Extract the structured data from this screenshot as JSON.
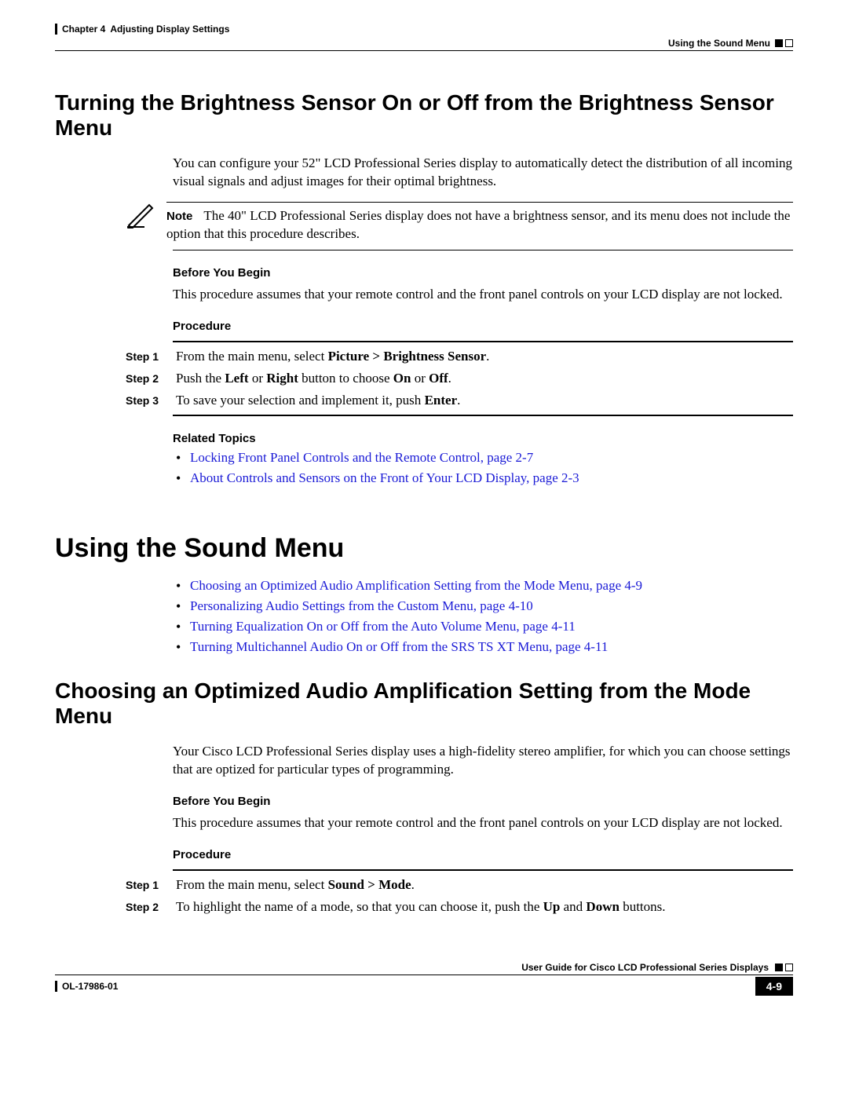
{
  "header": {
    "chapter_prefix": "Chapter 4",
    "chapter_title": "Adjusting Display Settings",
    "section": "Using the Sound Menu"
  },
  "s1": {
    "heading": "Turning the Brightness Sensor On or Off from the Brightness Sensor Menu",
    "intro": "You can configure your 52\" LCD Professional Series display to automatically detect the distribution of all incoming visual signals and adjust images for their optimal brightness.",
    "note_label": "Note",
    "note_text": "The 40\" LCD Professional Series display does not have a brightness sensor, and its menu does not include the option that this procedure describes.",
    "before_label": "Before You Begin",
    "before_text": "This procedure assumes that your remote control and the front panel controls on your LCD display are not locked.",
    "procedure_label": "Procedure",
    "steps": {
      "s1": {
        "label": "Step 1",
        "text_a": "From the main menu, select ",
        "b1": "Picture > Brightness Sensor",
        "text_b": "."
      },
      "s2": {
        "label": "Step 2",
        "text_a": "Push the ",
        "b1": "Left",
        "text_b": " or ",
        "b2": "Right",
        "text_c": " button to choose ",
        "b3": "On",
        "text_d": " or ",
        "b4": "Off",
        "text_e": "."
      },
      "s3": {
        "label": "Step 3",
        "text_a": "To save your selection and implement it, push ",
        "b1": "Enter",
        "text_b": "."
      }
    },
    "related_label": "Related Topics",
    "related": {
      "r1": "Locking Front Panel Controls and the Remote Control, page 2-7",
      "r2": "About Controls and Sensors on the Front of Your LCD Display, page 2-3"
    }
  },
  "s2": {
    "heading": "Using the Sound Menu",
    "links": {
      "l1": "Choosing an Optimized Audio Amplification Setting from the Mode Menu, page 4-9",
      "l2": "Personalizing Audio Settings from the Custom Menu, page 4-10",
      "l3": "Turning Equalization On or Off from the Auto Volume Menu, page 4-11",
      "l4": "Turning Multichannel Audio On or Off from the SRS TS XT Menu, page 4-11"
    }
  },
  "s3": {
    "heading": "Choosing an Optimized Audio Amplification Setting from the Mode Menu",
    "intro": "Your Cisco LCD Professional Series display uses a high-fidelity stereo amplifier, for which you can choose settings that are optized for particular types of programming.",
    "before_label": "Before You Begin",
    "before_text": "This procedure assumes that your remote control and the front panel controls on your LCD display are not locked.",
    "procedure_label": "Procedure",
    "steps": {
      "s1": {
        "label": "Step 1",
        "text_a": "From the main menu, select ",
        "b1": "Sound > Mode",
        "text_b": "."
      },
      "s2": {
        "label": "Step 2",
        "text_a": "To highlight the name of a mode, so that you can choose it, push the ",
        "b1": "Up",
        "text_b": " and ",
        "b2": "Down",
        "text_c": " buttons."
      }
    }
  },
  "footer": {
    "guide_title": "User Guide for Cisco LCD Professional Series Displays",
    "doc_id": "OL-17986-01",
    "page": "4-9"
  }
}
